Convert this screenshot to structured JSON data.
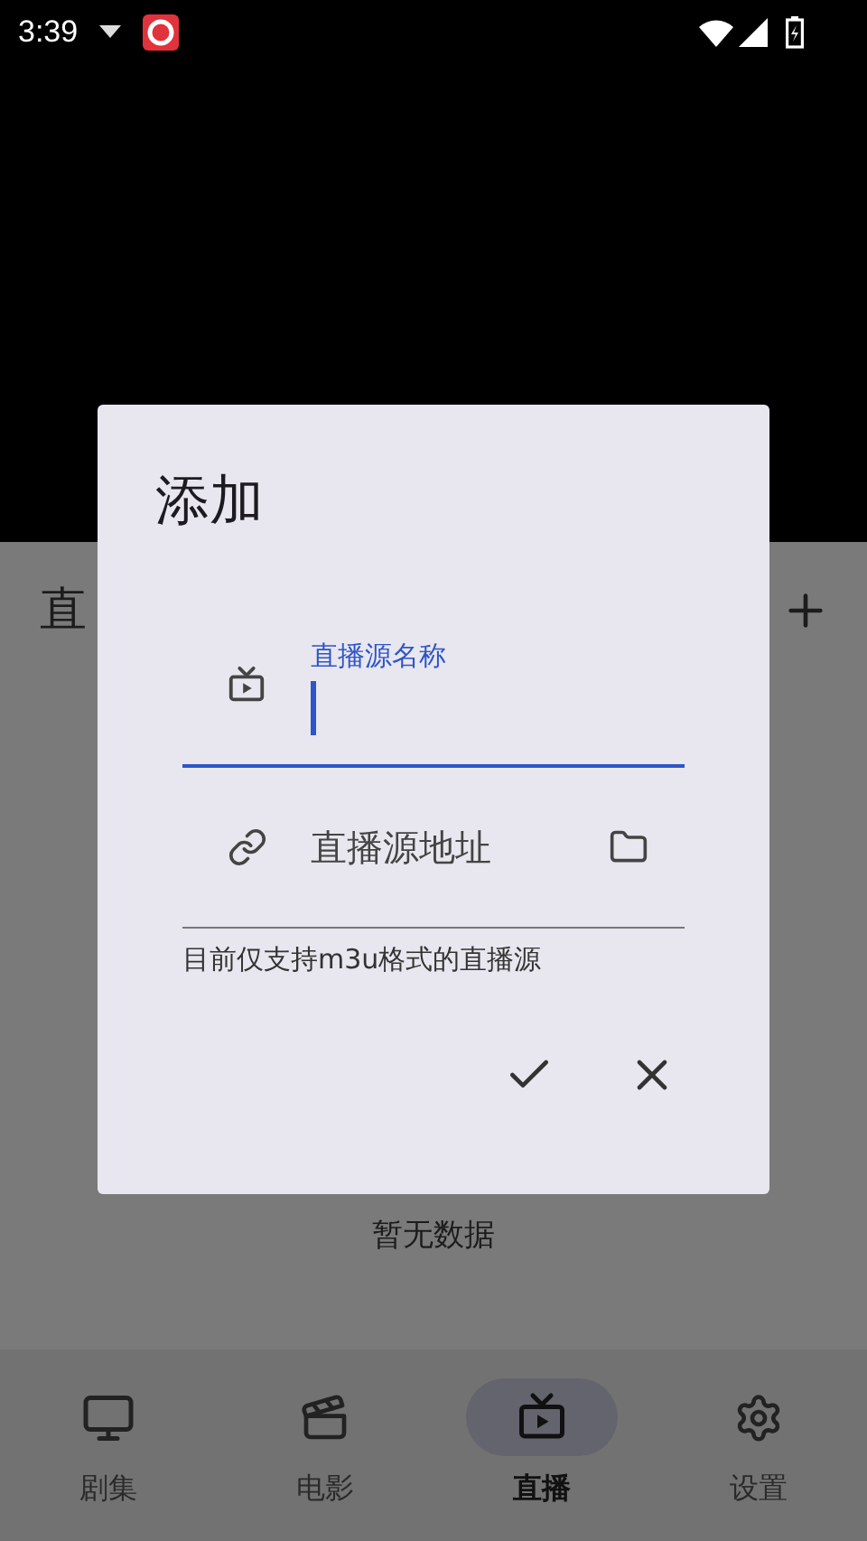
{
  "status_bar": {
    "time": "3:39"
  },
  "page": {
    "title": "直",
    "empty_text": "暂无数据"
  },
  "dialog": {
    "title": "添加",
    "fields": [
      {
        "label": "直播源名称",
        "focused": true
      },
      {
        "placeholder": "直播源地址",
        "focused": false
      }
    ],
    "helper": "目前仅支持m3u格式的直播源"
  },
  "nav": [
    {
      "label": "剧集",
      "selected": false
    },
    {
      "label": "电影",
      "selected": false
    },
    {
      "label": "直播",
      "selected": true
    },
    {
      "label": "设置",
      "selected": false
    }
  ]
}
